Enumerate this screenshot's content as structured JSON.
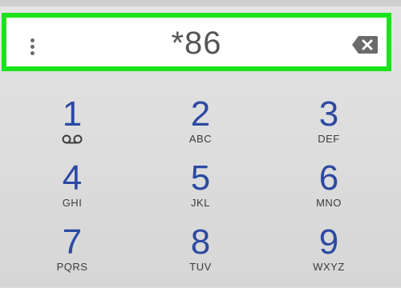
{
  "dial": {
    "entered": "*86"
  },
  "icons": {
    "menu": "more-vertical-icon",
    "backspace": "backspace-icon",
    "voicemail": "voicemail-icon"
  },
  "colors": {
    "highlight_border": "#1be31b",
    "digit": "#2c4aa3"
  },
  "keys": [
    {
      "digit": "1",
      "letters": ""
    },
    {
      "digit": "2",
      "letters": "ABC"
    },
    {
      "digit": "3",
      "letters": "DEF"
    },
    {
      "digit": "4",
      "letters": "GHI"
    },
    {
      "digit": "5",
      "letters": "JKL"
    },
    {
      "digit": "6",
      "letters": "MNO"
    },
    {
      "digit": "7",
      "letters": "PQRS"
    },
    {
      "digit": "8",
      "letters": "TUV"
    },
    {
      "digit": "9",
      "letters": "WXYZ"
    }
  ]
}
